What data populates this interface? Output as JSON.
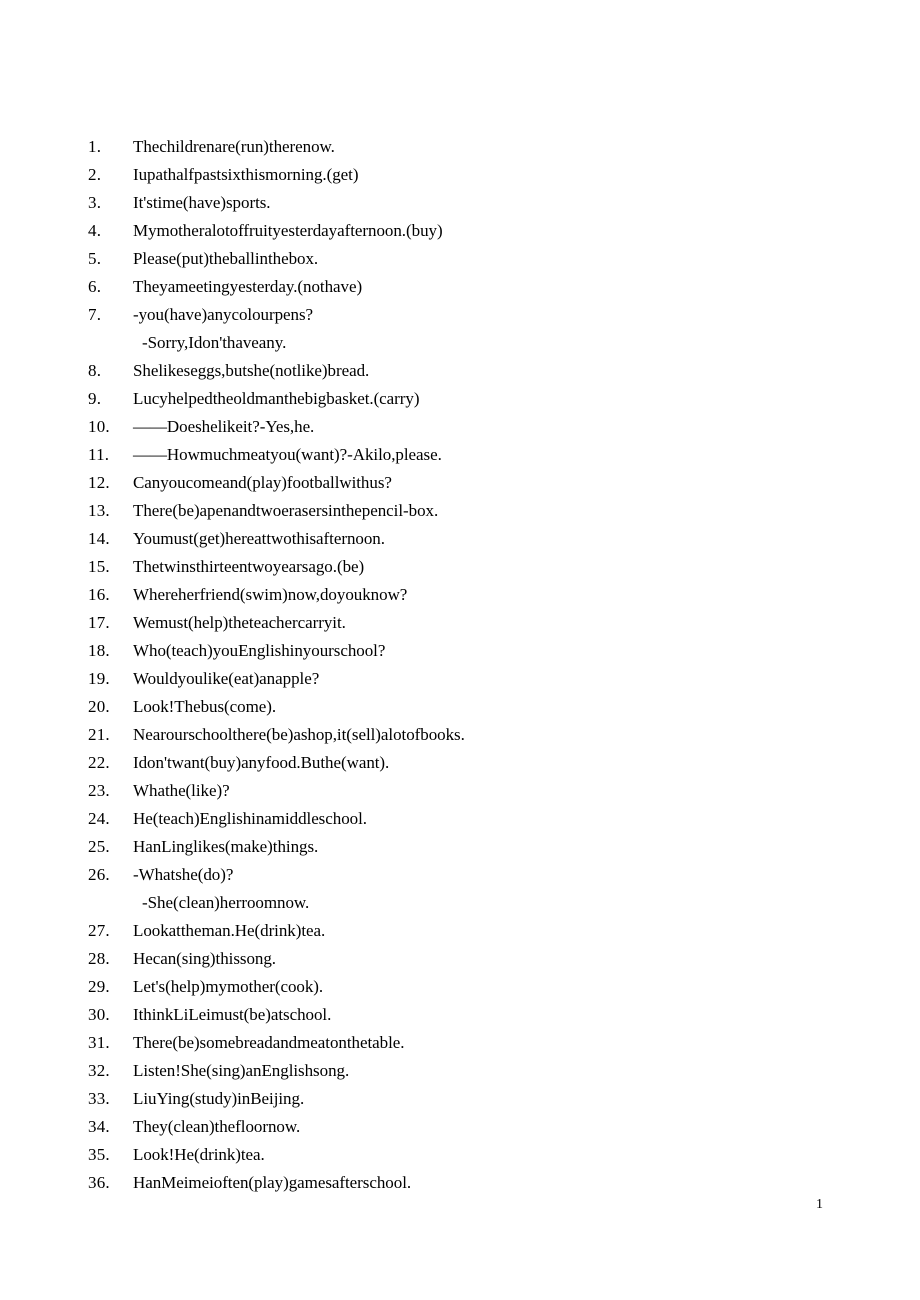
{
  "document": {
    "page_number": "1",
    "background_color": "#ffffff",
    "text_color": "#000000"
  },
  "exercises": [
    {
      "number": "1.",
      "text": "Thechildrenare(run)therenow."
    },
    {
      "number": "2.",
      "text": "Iupathalfpastsixthismorning.(get)"
    },
    {
      "number": "3.",
      "text": "It'stime(have)sports."
    },
    {
      "number": "4.",
      "text": "Mymotheralotoffruityesterdayafternoon.(buy)"
    },
    {
      "number": "5.",
      "text": "Please(put)theballinthebox."
    },
    {
      "number": "6.",
      "text": "Theyameetingyesterday.(nothave)"
    },
    {
      "number": "7.",
      "text": "-you(have)anycolourpens?",
      "subline": "-Sorry,Idon'thaveany."
    },
    {
      "number": "8.",
      "text": "Shelikeseggs,butshe(notlike)bread."
    },
    {
      "number": "9.",
      "text": "Lucyhelpedtheoldmanthebigbasket.(carry)"
    },
    {
      "number": "10.",
      "text": "——Doeshelikeit?-Yes,he."
    },
    {
      "number": "11.",
      "text": "——Howmuchmeatyou(want)?-Akilo,please."
    },
    {
      "number": "12.",
      "text": "Canyoucomeand(play)footballwithus?"
    },
    {
      "number": "13.",
      "text": "There(be)apenandtwoerasersinthepencil-box."
    },
    {
      "number": "14.",
      "text": "Youmust(get)hereattwothisafternoon."
    },
    {
      "number": "15.",
      "text": "Thetwinsthirteentwoyearsago.(be)"
    },
    {
      "number": "16.",
      "text": "Whereherfriend(swim)now,doyouknow?"
    },
    {
      "number": "17.",
      "text": "Wemust(help)theteachercarryit."
    },
    {
      "number": "18.",
      "text": "Who(teach)youEnglishinyourschool?"
    },
    {
      "number": "19.",
      "text": "Wouldyoulike(eat)anapple?"
    },
    {
      "number": "20.",
      "text": "Look!Thebus(come)."
    },
    {
      "number": "21.",
      "text": "Nearourschoolthere(be)ashop,it(sell)alotofbooks."
    },
    {
      "number": "22.",
      "text": "Idon'twant(buy)anyfood.Buthe(want)."
    },
    {
      "number": "23.",
      "text": "Whathe(like)?"
    },
    {
      "number": "24.",
      "text": "He(teach)Englishinamiddleschool."
    },
    {
      "number": "25.",
      "text": "HanLinglikes(make)things."
    },
    {
      "number": "26.",
      "text": "-Whatshe(do)?",
      "subline": "-She(clean)herroomnow."
    },
    {
      "number": "27.",
      "text": "Lookattheman.He(drink)tea."
    },
    {
      "number": "28.",
      "text": "Hecan(sing)thissong."
    },
    {
      "number": "29.",
      "text": "Let's(help)mymother(cook)."
    },
    {
      "number": "30.",
      "text": "IthinkLiLeimust(be)atschool."
    },
    {
      "number": "31.",
      "text": "There(be)somebreadandmeatonthetable."
    },
    {
      "number": "32.",
      "text": "Listen!She(sing)anEnglishsong."
    },
    {
      "number": "33.",
      "text": "LiuYing(study)inBeijing."
    },
    {
      "number": "34.",
      "text": "They(clean)thefloornow."
    },
    {
      "number": "35.",
      "text": "Look!He(drink)tea."
    },
    {
      "number": "36.",
      "text": "HanMeimeioften(play)gamesafterschool."
    }
  ]
}
